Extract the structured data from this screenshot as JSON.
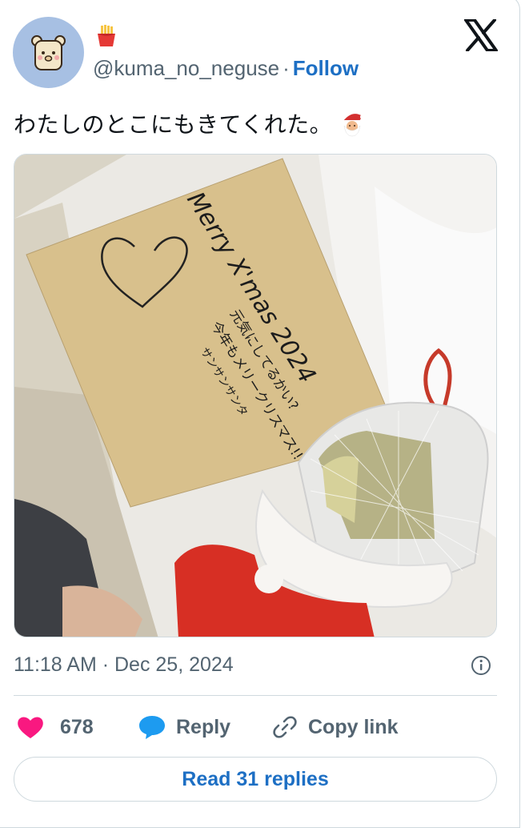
{
  "author": {
    "display_name_emoji": "fries-emoji",
    "handle": "@kuma_no_neguse",
    "separator": "·",
    "follow_label": "Follow"
  },
  "tweet": {
    "text": "わたしのとこにもきてくれた。",
    "trailing_emoji": "santa-emoji",
    "timestamp": "11:18 AM · Dec 25, 2024"
  },
  "photo_card_text": {
    "line1": "Merry X'mas 2024",
    "line2": "元気にしてるかい?",
    "line3": "今年もメリークリスマス!!",
    "line4": "サンサンサンタ"
  },
  "actions": {
    "like_count": "678",
    "reply_label": "Reply",
    "copy_label": "Copy link"
  },
  "read_replies_label": "Read 31 replies",
  "colors": {
    "link_blue": "#1d6fc4",
    "like_pink": "#f91880",
    "reply_blue": "#1d9bf0",
    "muted": "#536471",
    "border": "#cfd9de"
  }
}
